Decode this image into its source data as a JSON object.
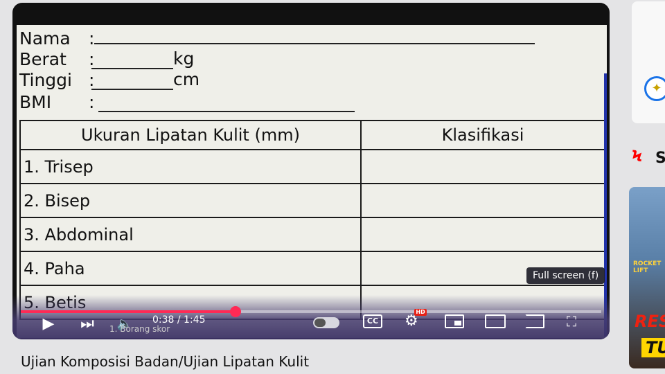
{
  "form": {
    "nama_label": "Nama",
    "berat_label": "Berat",
    "tinggi_label": "Tinggi",
    "bmi_label": "BMI",
    "colon": ":",
    "kg_unit": "kg",
    "cm_unit": "cm",
    "table": {
      "headers": [
        "Ukuran Lipatan Kulit (mm)",
        "Klasifikasi"
      ],
      "rows": [
        "1.  Trisep",
        "2.  Bisep",
        "3. Abdominal",
        "4. Paha",
        "5. Betis"
      ]
    }
  },
  "player": {
    "time": "0:38 / 1:45",
    "chapter": "1. Borang skor",
    "progress_fraction": 0.37,
    "tooltip": "Full screen (f)",
    "cc_label": "CC",
    "hd_label": "HD"
  },
  "video": {
    "title": "Ujian Komposisi Badan/Ujian Lipatan Kulit"
  },
  "sidebar": {
    "shorts_partial": "S",
    "thumb_caption_small": "ROCKET\nLIFT",
    "thumb_caption_red": "RES",
    "thumb_caption_yellow": "TU"
  }
}
